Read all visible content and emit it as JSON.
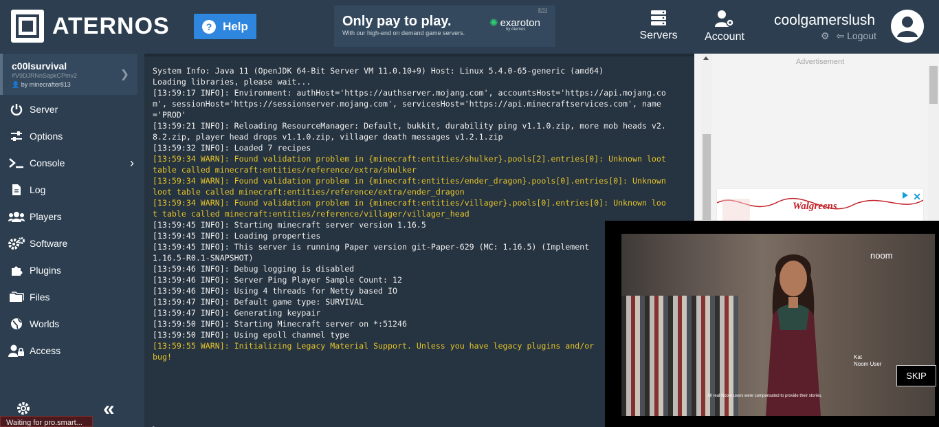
{
  "header": {
    "logo_text": "ATERNOS",
    "help_label": "Help",
    "banner": {
      "headline": "Only pay to play.",
      "subline": "With our high-end on demand game servers.",
      "brand": "exaroton",
      "brand_by": "by Aternos",
      "ad_tag": "Ad"
    },
    "nav": [
      {
        "label": "Servers",
        "icon": "servers-icon"
      },
      {
        "label": "Account",
        "icon": "account-icon"
      }
    ],
    "user": {
      "username": "coolgamerslush",
      "logout_label": "Logout"
    }
  },
  "sidebar": {
    "server_name": "c00lsurvival",
    "server_id": "#V9DJRNnSapkCPmv2",
    "server_owner": "by minecrafter813",
    "items": [
      {
        "label": "Server",
        "icon": "power-icon"
      },
      {
        "label": "Options",
        "icon": "sliders-icon"
      },
      {
        "label": "Console",
        "icon": "terminal-icon"
      },
      {
        "label": "Log",
        "icon": "file-icon"
      },
      {
        "label": "Players",
        "icon": "users-icon"
      },
      {
        "label": "Software",
        "icon": "cogs-icon"
      },
      {
        "label": "Plugins",
        "icon": "puzzle-icon"
      },
      {
        "label": "Files",
        "icon": "folder-icon"
      },
      {
        "label": "Worlds",
        "icon": "globe-icon"
      },
      {
        "label": "Access",
        "icon": "user-lock-icon"
      }
    ],
    "collapse_label": "«",
    "status_text": "Waiting for pro.smart..."
  },
  "console": {
    "lines": [
      {
        "text": "System Info: Java 11 (OpenJDK 64-Bit Server VM 11.0.10+9) Host: Linux 5.4.0-65-generic (amd64)",
        "level": "info"
      },
      {
        "text": "Loading libraries, please wait...",
        "level": "info"
      },
      {
        "text": "[13:59:17 INFO]: Environment: authHost='https://authserver.mojang.com', accountsHost='https://api.mojang.co",
        "level": "info"
      },
      {
        "text": "m', sessionHost='https://sessionserver.mojang.com', servicesHost='https://api.minecraftservices.com', name",
        "level": "info"
      },
      {
        "text": "='PROD'",
        "level": "info"
      },
      {
        "text": "[13:59:21 INFO]: Reloading ResourceManager: Default, bukkit, durability ping v1.1.0.zip, more mob heads v2.",
        "level": "info"
      },
      {
        "text": "8.2.zip, player head drops v1.1.0.zip, villager death messages v1.2.1.zip",
        "level": "info"
      },
      {
        "text": "[13:59:32 INFO]: Loaded 7 recipes",
        "level": "info"
      },
      {
        "text": "[13:59:34 WARN]: Found validation problem in {minecraft:entities/shulker}.pools[2].entries[0]: Unknown loot",
        "level": "warn"
      },
      {
        "text": "table called minecraft:entities/reference/extra/shulker",
        "level": "warn"
      },
      {
        "text": "[13:59:34 WARN]: Found validation problem in {minecraft:entities/ender_dragon}.pools[0].entries[0]: Unknown",
        "level": "warn"
      },
      {
        "text": "loot table called minecraft:entities/reference/extra/ender_dragon",
        "level": "warn"
      },
      {
        "text": "[13:59:34 WARN]: Found validation problem in {minecraft:entities/villager}.pools[0].entries[0]: Unknown loo",
        "level": "warn"
      },
      {
        "text": "t table called minecraft:entities/reference/villager/villager_head",
        "level": "warn"
      },
      {
        "text": "[13:59:45 INFO]: Starting minecraft server version 1.16.5",
        "level": "info"
      },
      {
        "text": "[13:59:45 INFO]: Loading properties",
        "level": "info"
      },
      {
        "text": "[13:59:45 INFO]: This server is running Paper version git-Paper-629 (MC: 1.16.5) (Implement",
        "level": "info"
      },
      {
        "text": "1.16.5-R0.1-SNAPSHOT)",
        "level": "info"
      },
      {
        "text": "[13:59:46 INFO]: Debug logging is disabled",
        "level": "info"
      },
      {
        "text": "[13:59:46 INFO]: Server Ping Player Sample Count: 12",
        "level": "info"
      },
      {
        "text": "[13:59:46 INFO]: Using 4 threads for Netty based IO",
        "level": "info"
      },
      {
        "text": "[13:59:47 INFO]: Default game type: SURVIVAL",
        "level": "info"
      },
      {
        "text": "[13:59:47 INFO]: Generating keypair",
        "level": "info"
      },
      {
        "text": "[13:59:50 INFO]: Starting Minecraft server on *:51246",
        "level": "info"
      },
      {
        "text": "[13:59:50 INFO]: Using epoll channel type",
        "level": "info"
      },
      {
        "text": "[13:59:55 WARN]: Initializing Legacy Material Support. Unless you have legacy plugins and/or",
        "level": "warn"
      },
      {
        "text": "bug!",
        "level": "warn"
      }
    ],
    "prompt": ">"
  },
  "ads": {
    "label": "Advertisement",
    "walgreens": "Walgreens",
    "video": {
      "brand": "noom",
      "caption_name": "Kat",
      "caption_role": "Noom User",
      "disclaimer": "All real Noom users were compensated to provide their stories.",
      "skip_label": "SKIP"
    }
  },
  "colors": {
    "background": "#2c3e50",
    "accent": "#2e86de",
    "warn": "#e5c52b"
  }
}
